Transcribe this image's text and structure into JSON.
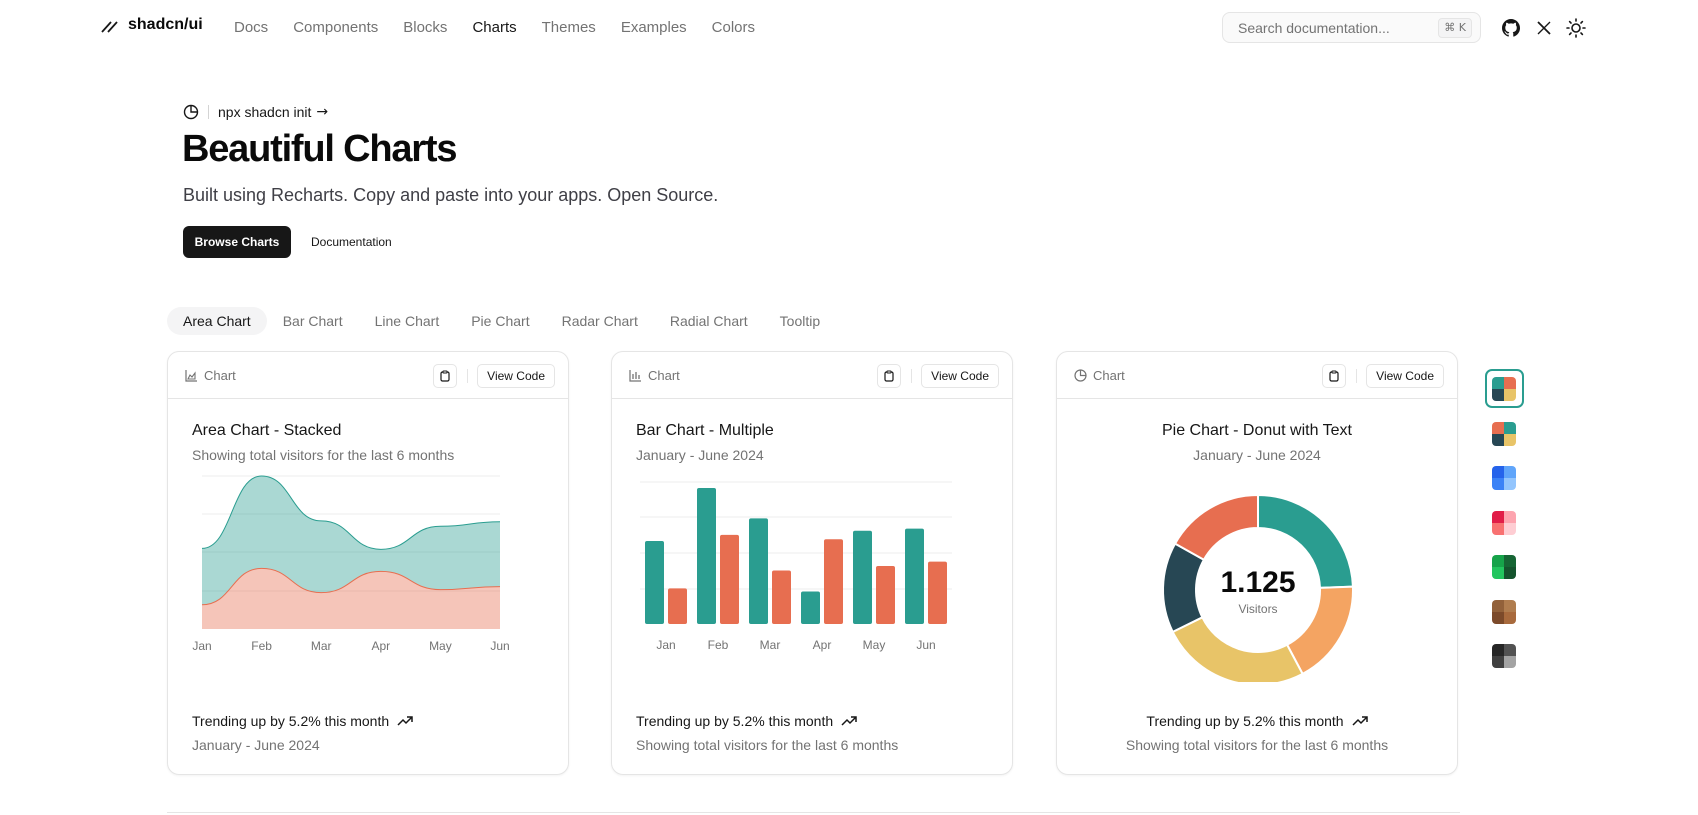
{
  "header": {
    "brand": "shadcn/ui",
    "nav": [
      "Docs",
      "Components",
      "Blocks",
      "Charts",
      "Themes",
      "Examples",
      "Colors"
    ],
    "active_nav": "Charts",
    "search_placeholder": "Search documentation...",
    "search_shortcut": "⌘ K"
  },
  "hero": {
    "announcement": "npx shadcn init",
    "title": "Beautiful Charts",
    "subtitle": "Built using Recharts. Copy and paste into your apps. Open Source.",
    "primary_button": "Browse Charts",
    "secondary_button": "Documentation"
  },
  "tabs": [
    "Area Chart",
    "Bar Chart",
    "Line Chart",
    "Pie Chart",
    "Radar Chart",
    "Radial Chart",
    "Tooltip"
  ],
  "active_tab": "Area Chart",
  "card_toolbar": {
    "label": "Chart",
    "view_code": "View Code"
  },
  "colors": {
    "chart1": "#2a9d90",
    "chart2": "#e76e50",
    "chart3": "#274754",
    "chart4": "#e8c468",
    "chart5": "#f4a462"
  },
  "chart_data": [
    {
      "type": "area",
      "title": "Area Chart - Stacked",
      "subtitle": "Showing total visitors for the last 6 months",
      "categories": [
        "Jan",
        "Feb",
        "Mar",
        "Apr",
        "May",
        "Jun"
      ],
      "series": [
        {
          "values": [
            80,
            200,
            120,
            190,
            130,
            140
          ]
        },
        {
          "values": [
            186,
            305,
            237,
            73,
            209,
            214
          ]
        }
      ],
      "footer": {
        "trend": "Trending up by 5.2% this month",
        "range": "January - June 2024"
      }
    },
    {
      "type": "bar",
      "title": "Bar Chart - Multiple",
      "subtitle": "January - June 2024",
      "categories": [
        "Jan",
        "Feb",
        "Mar",
        "Apr",
        "May",
        "Jun"
      ],
      "series": [
        {
          "values": [
            186,
            305,
            237,
            73,
            209,
            214
          ]
        },
        {
          "values": [
            80,
            200,
            120,
            190,
            130,
            140
          ]
        }
      ],
      "footer": {
        "trend": "Trending up by 5.2% this month",
        "range": "Showing total visitors for the last 6 months"
      }
    },
    {
      "type": "pie",
      "title": "Pie Chart - Donut with Text",
      "subtitle": "January - June 2024",
      "center_value": "1.125",
      "center_label": "Visitors",
      "slices": [
        275,
        200,
        287,
        173,
        190
      ],
      "slice_colors": [
        "#2a9d90",
        "#f4a462",
        "#e8c468",
        "#274754",
        "#e76e50"
      ],
      "footer": {
        "trend": "Trending up by 5.2% this month",
        "range": "Showing total visitors for the last 6 months"
      }
    }
  ],
  "swatches": [
    [
      "#2a9d90",
      "#e76e50",
      "#274754",
      "#e8c468"
    ],
    [
      "#e76e50",
      "#2a9d90",
      "#274754",
      "#e8c468"
    ],
    [
      "#2563eb",
      "#60a5fa",
      "#3b82f6",
      "#93c5fd"
    ],
    [
      "#e11d48",
      "#fda4af",
      "#f87171",
      "#fecdd3"
    ],
    [
      "#16a34a",
      "#166534",
      "#22c55e",
      "#14532d"
    ],
    [
      "#92613a",
      "#b07d4f",
      "#7c4a2a",
      "#a86a3d"
    ],
    [
      "#262626",
      "#525252",
      "#404040",
      "#a3a3a3"
    ]
  ]
}
